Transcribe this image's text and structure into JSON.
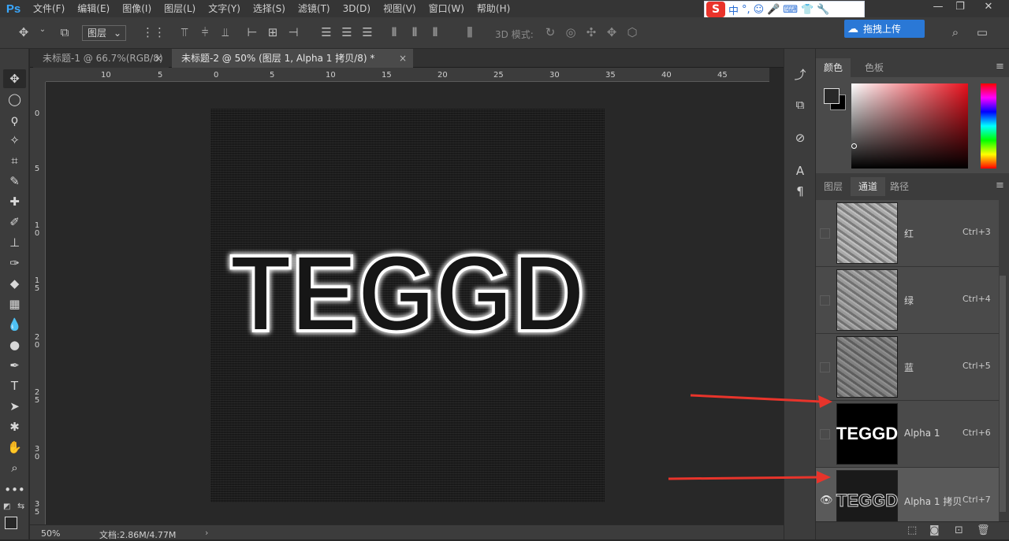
{
  "app": {
    "logo": "Ps"
  },
  "menu": [
    "文件(F)",
    "编辑(E)",
    "图像(I)",
    "图层(L)",
    "文字(Y)",
    "选择(S)",
    "滤镜(T)",
    "3D(D)",
    "视图(V)",
    "窗口(W)",
    "帮助(H)"
  ],
  "ime": {
    "logo": "S",
    "items": [
      "中",
      "°,",
      "☺",
      "🎤",
      "⌨",
      "👕",
      "🔧"
    ]
  },
  "upload": {
    "label": "拖拽上传"
  },
  "window_controls": [
    "—",
    "❐",
    "✕"
  ],
  "options_bar": {
    "layer_select": "图层",
    "mode_3d": "3D 模式:"
  },
  "tabs": [
    {
      "label": "未标题-1 @ 66.7%(RGB/8)",
      "close": "×"
    },
    {
      "label": "未标题-2 @ 50% (图层 1, Alpha 1 拷贝/8) *",
      "close": "×"
    }
  ],
  "ruler": {
    "top": [
      "10",
      "5",
      "0",
      "5",
      "10",
      "15",
      "20",
      "25",
      "30",
      "35",
      "40",
      "45"
    ],
    "left": [
      "0",
      "5",
      "10",
      "15",
      "20",
      "25",
      "30",
      "35"
    ]
  },
  "document": {
    "text": "TEGGD"
  },
  "status": {
    "zoom": "50%",
    "doc_size": "文档:2.86M/4.77M",
    "arrow": "›"
  },
  "color_panel": {
    "tabs": [
      "颜色",
      "色板"
    ],
    "menu": "≡"
  },
  "channels_panel": {
    "tabs": [
      "图层",
      "通道",
      "路径"
    ],
    "menu": "≡",
    "channels": [
      {
        "name": "红",
        "shortcut": "Ctrl+3",
        "thumb": "rock",
        "visible": false,
        "selected": false
      },
      {
        "name": "绿",
        "shortcut": "Ctrl+4",
        "thumb": "rock",
        "visible": false,
        "selected": false
      },
      {
        "name": "蓝",
        "shortcut": "Ctrl+5",
        "thumb": "rock",
        "visible": false,
        "selected": false
      },
      {
        "name": "Alpha 1",
        "shortcut": "Ctrl+6",
        "thumb": "text",
        "thumb_text": "TEGGD",
        "visible": false,
        "selected": false
      },
      {
        "name": "Alpha 1 拷贝",
        "shortcut": "Ctrl+7",
        "thumb": "text-outline",
        "thumb_text": "TEGGD",
        "visible": true,
        "selected": true
      }
    ]
  },
  "colors": {
    "accent": "#e8342b",
    "ps_blue": "#3aa8ff",
    "panel": "#3c3c3c",
    "canvas": "#161616"
  }
}
